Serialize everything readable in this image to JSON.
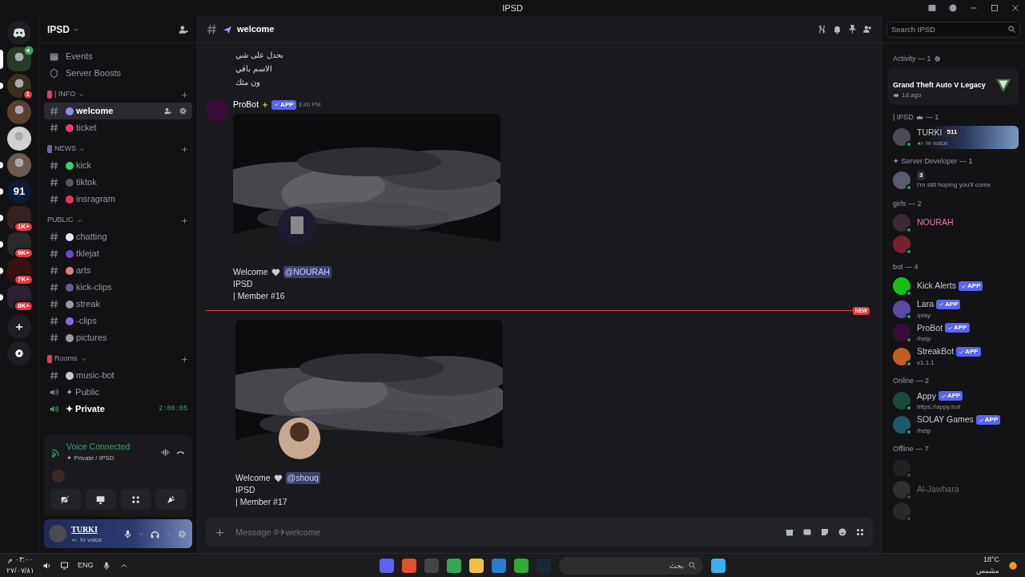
{
  "titlebar": {
    "title": "IPSD"
  },
  "servers": [
    {
      "kind": "avatar",
      "selected": true,
      "unread": false,
      "voice": true
    },
    {
      "kind": "avatar",
      "selected": false,
      "unread": true,
      "badge": "1"
    },
    {
      "kind": "avatar",
      "selected": false,
      "unread": false
    },
    {
      "kind": "avatar",
      "selected": false,
      "unread": false
    },
    {
      "kind": "avatar",
      "selected": false,
      "unread": true
    },
    {
      "kind": "text",
      "label": "91",
      "selected": false,
      "unread": true
    },
    {
      "kind": "folder",
      "selected": false,
      "unread": true,
      "badge": "1K+"
    },
    {
      "kind": "folder",
      "selected": false,
      "unread": true,
      "badge": "9K+"
    },
    {
      "kind": "folder",
      "selected": false,
      "unread": true,
      "badge": "7K+"
    },
    {
      "kind": "folder",
      "selected": false,
      "unread": true,
      "badge": "8K+"
    }
  ],
  "server": {
    "name": "IPSD"
  },
  "sidebar": {
    "links": [
      {
        "kind": "events",
        "label": "Events"
      },
      {
        "kind": "boosts",
        "label": "Server Boosts"
      }
    ],
    "categories": [
      {
        "name": "| INFO",
        "color": "#e0405f",
        "channels": [
          {
            "kind": "text",
            "name": "welcome",
            "color": "#8f8fe8",
            "selected": true
          },
          {
            "kind": "text",
            "name": "ticket",
            "color": "#e0406a",
            "selected": false
          }
        ]
      },
      {
        "name": "NEWS",
        "color": "#6b6b9a",
        "channels": [
          {
            "kind": "text",
            "name": "kick",
            "color": "#3ccf6b",
            "selected": false
          },
          {
            "kind": "text",
            "name": "tiktok",
            "color": "#55556a",
            "selected": false
          },
          {
            "kind": "text",
            "name": "insragram",
            "color": "#e03a5c",
            "selected": false
          }
        ]
      },
      {
        "name": "PUBLIC",
        "channels": [
          {
            "kind": "text",
            "name": "chatting",
            "color": "#e8e8f0",
            "selected": false
          },
          {
            "kind": "text",
            "name": "tklejat",
            "color": "#6a48c8",
            "selected": false
          },
          {
            "kind": "text",
            "name": "arts",
            "color": "#e07a8a",
            "selected": false
          },
          {
            "kind": "text",
            "name": "kick-clips",
            "color": "#6a5a9a",
            "selected": false
          },
          {
            "kind": "text",
            "name": "streak",
            "color": "#9a9aa4",
            "selected": false
          },
          {
            "kind": "text",
            "name": "-clips",
            "color": "#8a6ae0",
            "selected": false
          },
          {
            "kind": "text",
            "name": "pictures",
            "color": "#9a9aa4",
            "selected": false
          }
        ]
      },
      {
        "name": "Rooms",
        "color": "#e0405f",
        "channels": [
          {
            "kind": "text",
            "name": "music-bot",
            "color": "#c8c8d0",
            "selected": false
          },
          {
            "kind": "voice",
            "name": "✦ Public",
            "selected": false,
            "connected": false
          },
          {
            "kind": "voice",
            "name": "✦ Private",
            "selected": false,
            "connected": true,
            "timer": "2:00:05"
          }
        ]
      }
    ]
  },
  "voice_panel": {
    "status": "Voice Connected",
    "location": "✦ Private / IPSD"
  },
  "user_panel": {
    "name": "TURKI",
    "status": "In voice"
  },
  "channel_header": {
    "name": "welcome",
    "search_placeholder": "Search IPSD"
  },
  "messages": [
    {
      "kind": "lines",
      "lines": [
        "بحدل على شي",
        "الاسم باقي",
        "ون مثك"
      ]
    },
    {
      "kind": "bot",
      "author": "ProBot",
      "badge": "APP",
      "time": "3:46 PM",
      "greeting": "Welcome",
      "mention": "@NOURAH",
      "lines": [
        "IPSD",
        "| Member #16"
      ]
    },
    {
      "kind": "divider",
      "label": "NEW"
    },
    {
      "kind": "continued",
      "greeting": "Welcome",
      "mention": "@shouq",
      "lines": [
        "IPSD",
        "| Member #17"
      ]
    }
  ],
  "composer": {
    "placeholder": "Message #✈welcome"
  },
  "members": {
    "activity": {
      "heading": "Activity — 1",
      "game": "Grand Theft Auto V Legacy",
      "time": "1d ago"
    },
    "groups": [
      {
        "heading": "| IPSD",
        "count": "— 1",
        "crown": true,
        "members": [
          {
            "name": "TURKI",
            "tag": "511",
            "subtitle": "In voice",
            "in_voice": true,
            "online": true
          }
        ]
      },
      {
        "heading": "✦ Server Developer — 1",
        "members": [
          {
            "tag": "3",
            "subtitle": "I'm still hoping you'll come",
            "online": true
          }
        ]
      },
      {
        "heading": "girls — 2",
        "members": [
          {
            "name": "NOURAH",
            "color": "#e87aa8",
            "online": true
          },
          {
            "online": true
          }
        ]
      },
      {
        "heading": "bot — 4",
        "members": [
          {
            "name": "Kick Alerts",
            "app": "APP",
            "online": true
          },
          {
            "name": "Lara",
            "app": "APP",
            "subtitle": "/play",
            "online": true
          },
          {
            "name": "ProBot",
            "app": "APP",
            "subtitle": "/help",
            "online": true
          },
          {
            "name": "StreakBot",
            "app": "APP",
            "subtitle": "v1.1.1",
            "online": true
          }
        ]
      },
      {
        "heading": "Online — 2",
        "members": [
          {
            "name": "Appy",
            "app": "APP",
            "subtitle": "https://appy.bot",
            "online": true
          },
          {
            "name": "SOLAY Games",
            "app": "APP",
            "subtitle": "/help",
            "online": true
          }
        ]
      },
      {
        "heading": "Offline — 7",
        "members": [
          {
            "online": false
          },
          {
            "name": "Al-Jawhara",
            "online": false
          },
          {
            "online": false
          }
        ]
      }
    ]
  },
  "taskbar": {
    "time": "٠٣:٠٠ م",
    "date": "٢٧/٠٧/٨١",
    "language": "ENG",
    "search_placeholder": "بحث",
    "temperature": "18°C",
    "weather": "مشمس"
  }
}
